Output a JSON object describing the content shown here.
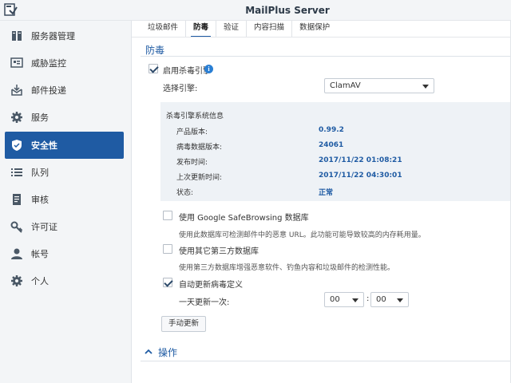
{
  "window": {
    "title": "MailPlus Server"
  },
  "colors": {
    "accent": "#1f5ba3",
    "sidebar_bg": "#f3f5f7",
    "panel_bg": "#eef2f6",
    "active_item_bg": "#1f5ba3"
  },
  "sidebar": {
    "items": [
      {
        "label": "服务器管理",
        "icon": "server-management-icon"
      },
      {
        "label": "威胁监控",
        "icon": "threat-monitor-icon"
      },
      {
        "label": "邮件投递",
        "icon": "mail-delivery-icon"
      },
      {
        "label": "服务",
        "icon": "gear-icon"
      },
      {
        "label": "安全性",
        "icon": "shield-icon",
        "active": true
      },
      {
        "label": "队列",
        "icon": "list-icon"
      },
      {
        "label": "审核",
        "icon": "document-icon"
      },
      {
        "label": "许可证",
        "icon": "key-icon"
      },
      {
        "label": "帐号",
        "icon": "user-icon"
      },
      {
        "label": "个人",
        "icon": "gear-user-icon"
      }
    ]
  },
  "tabs": [
    {
      "label": "垃圾邮件"
    },
    {
      "label": "防毒",
      "active": true
    },
    {
      "label": "验证"
    },
    {
      "label": "内容扫描"
    },
    {
      "label": "数据保护"
    }
  ],
  "antivirus": {
    "section_title": "防毒",
    "enable_engine_label": "启用杀毒引擎",
    "enable_engine_checked": true,
    "select_engine_label": "选择引擎:",
    "engine_value": "ClamAV",
    "info_panel": {
      "title": "杀毒引擎系统信息",
      "rows": [
        {
          "label": "产品版本:",
          "value": "0.99.2"
        },
        {
          "label": "病毒数据版本:",
          "value": "24061"
        },
        {
          "label": "发布时间:",
          "value": "2017/11/22 01:08:21"
        },
        {
          "label": "上次更新时间:",
          "value": "2017/11/22 04:30:01"
        },
        {
          "label": "状态:",
          "value": "正常"
        }
      ]
    },
    "safebrowsing_label": "使用 Google SafeBrowsing 数据库",
    "safebrowsing_checked": false,
    "safebrowsing_desc": "使用此数据库可检测邮件中的恶意 URL。此功能可能导致较高的内存耗用量。",
    "thirdparty_label": "使用其它第三方数据库",
    "thirdparty_checked": false,
    "thirdparty_desc": "使用第三方数据库增强恶意软件、钓鱼内容和垃圾邮件的检测性能。",
    "auto_update_label": "自动更新病毒定义",
    "auto_update_checked": true,
    "daily_update_label": "一天更新一次:",
    "hour_value": "00",
    "time_separator": ":",
    "minute_value": "00",
    "manual_update_button": "手动更新"
  },
  "operations": {
    "title": "操作"
  }
}
